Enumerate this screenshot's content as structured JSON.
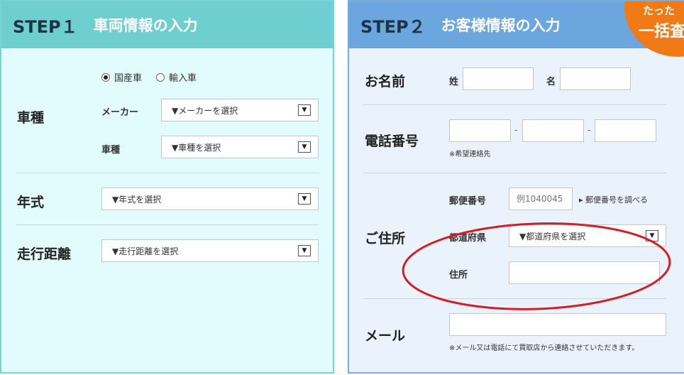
{
  "step1": {
    "step_label": "STEP１",
    "title": "車両情報の入力",
    "car_type_label": "車種",
    "radio_domestic": "国産車",
    "radio_import": "輸入車",
    "maker_label": "メーカー",
    "maker_select": "▼メーカーを選択",
    "model_label": "車種",
    "model_select": "▼車種を選択",
    "year_label": "年式",
    "year_select": "▼年式を選択",
    "mileage_label": "走行距離",
    "mileage_select": "▼走行距離を選択"
  },
  "step2": {
    "step_label": "STEP２",
    "title": "お客様情報の入力",
    "badge_top": "たった",
    "badge_bottom": "一括査",
    "name_label": "お名前",
    "last_name_label": "姓",
    "first_name_label": "名",
    "phone_label": "電話番号",
    "phone_dash": "-",
    "phone_note": "※希望連絡先",
    "address_label": "ご住所",
    "postal_label": "郵便番号",
    "postal_placeholder": "例1040045",
    "postal_lookup": "▸ 郵便番号を調べる",
    "prefecture_label": "都道府県",
    "prefecture_select": "▼都道府県を選択",
    "street_label": "住所",
    "email_label": "メール",
    "email_note": "※メール又は電話にて買取店から連絡させていただきます。"
  },
  "colors": {
    "step1_header": "#6fcfd0",
    "step2_header": "#6ca6df",
    "badge": "#f07a16",
    "annotation": "#d81c24"
  },
  "icons": {
    "select_arrow": "chevron-down-icon"
  }
}
